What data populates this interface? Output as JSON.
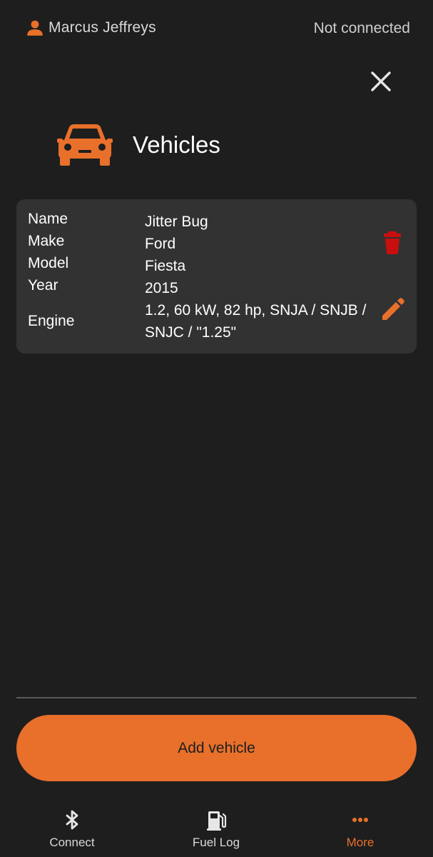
{
  "topbar": {
    "user_icon": "person-icon",
    "user_name": "Marcus Jeffreys",
    "connection_status": "Not connected"
  },
  "header": {
    "close_icon": "close-icon",
    "icon": "car-icon",
    "title": "Vehicles"
  },
  "vehicles": [
    {
      "fields": {
        "name": {
          "label": "Name",
          "value": "Jitter Bug"
        },
        "make": {
          "label": "Make",
          "value": "Ford"
        },
        "model": {
          "label": "Model",
          "value": "Fiesta"
        },
        "year": {
          "label": "Year",
          "value": "2015"
        },
        "engine": {
          "label": "Engine",
          "value": "1.2, 60 kW, 82 hp, SNJA / SNJB / SNJC / \"1.25\""
        }
      },
      "delete_icon": "trash-icon",
      "edit_icon": "pencil-icon"
    }
  ],
  "actions": {
    "add_label": "Add vehicle"
  },
  "bottom_nav": {
    "items": [
      {
        "label": "Connect",
        "icon": "bluetooth-icon",
        "active": false
      },
      {
        "label": "Fuel Log",
        "icon": "fuel-pump-icon",
        "active": false
      },
      {
        "label": "More",
        "icon": "more-horizontal-icon",
        "active": true
      }
    ]
  },
  "colors": {
    "background": "#1e1e1e",
    "card": "#323232",
    "accent": "#e8702b",
    "delete": "#c80f0f",
    "text_muted": "#d9d9d9"
  }
}
